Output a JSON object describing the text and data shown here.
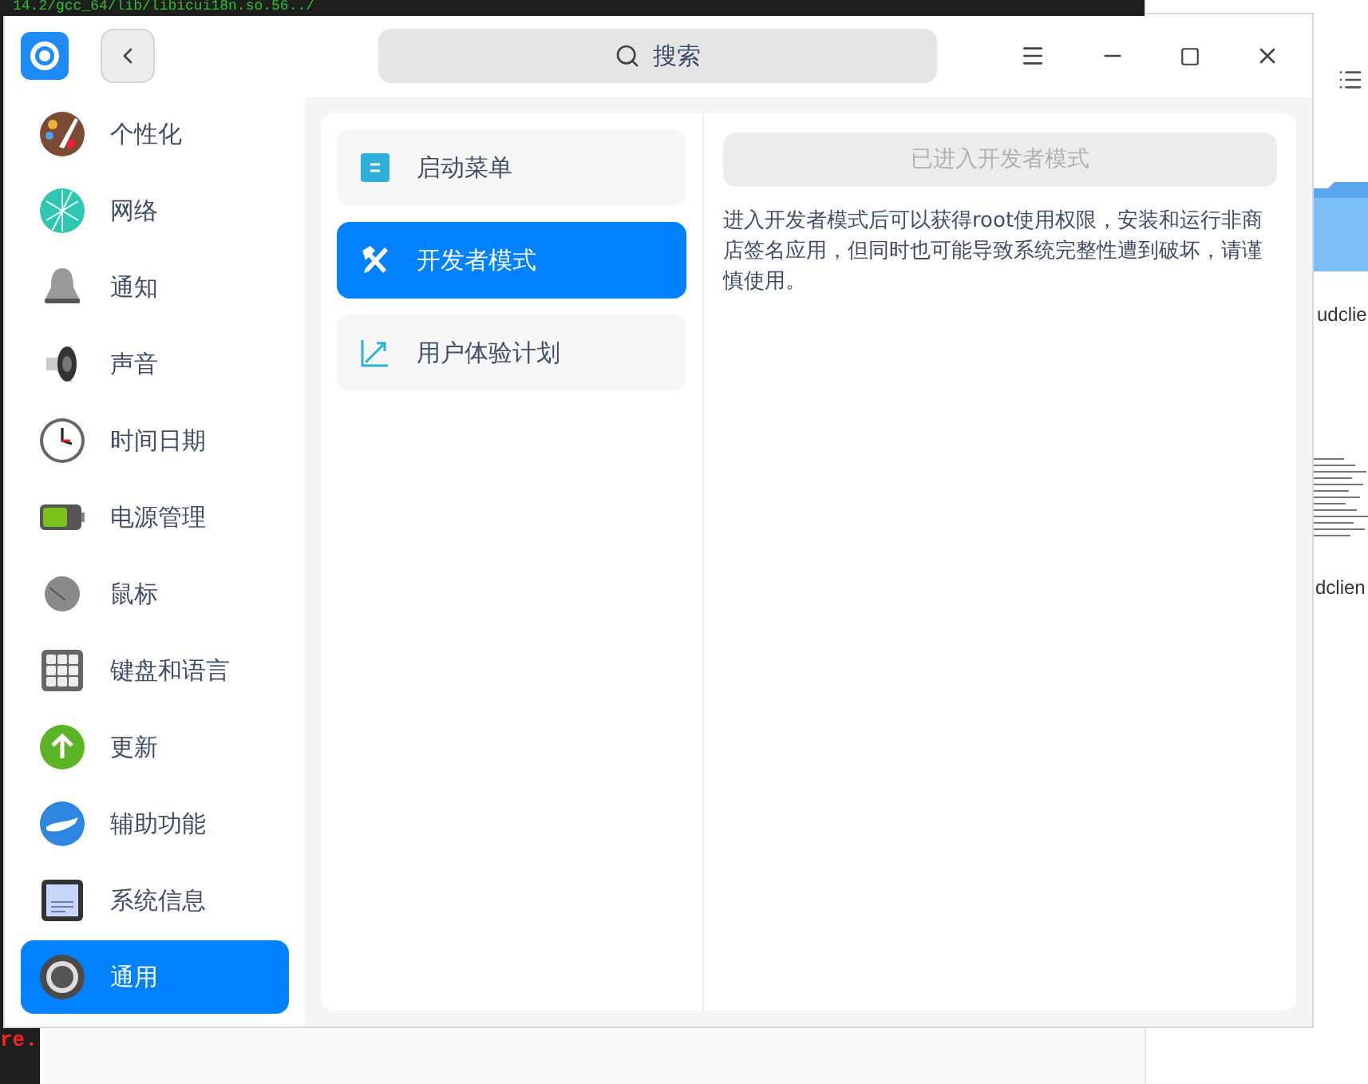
{
  "background": {
    "terminal_top_text": "14.2/gcc_64/lib/libicui18n.so.56../",
    "terminal_bottom_text": "re.",
    "file_labels": [
      "udclie",
      "dclien"
    ]
  },
  "window": {
    "search": {
      "placeholder": "搜索"
    }
  },
  "sidebar": {
    "items": [
      {
        "label": "个性化",
        "selected": false
      },
      {
        "label": "网络",
        "selected": false
      },
      {
        "label": "通知",
        "selected": false
      },
      {
        "label": "声音",
        "selected": false
      },
      {
        "label": "时间日期",
        "selected": false
      },
      {
        "label": "电源管理",
        "selected": false
      },
      {
        "label": "鼠标",
        "selected": false
      },
      {
        "label": "键盘和语言",
        "selected": false
      },
      {
        "label": "更新",
        "selected": false
      },
      {
        "label": "辅助功能",
        "selected": false
      },
      {
        "label": "系统信息",
        "selected": false
      },
      {
        "label": "通用",
        "selected": true
      }
    ]
  },
  "sub_menu": {
    "items": [
      {
        "label": "启动菜单",
        "selected": false
      },
      {
        "label": "开发者模式",
        "selected": true
      },
      {
        "label": "用户体验计划",
        "selected": false
      }
    ]
  },
  "developer_mode": {
    "button": {
      "label": "已进入开发者模式",
      "disabled": true
    },
    "description": "进入开发者模式后可以获得root使用权限，安装和运行非商店签名应用，但同时也可能导致系统完整性遭到破坏，请谨慎使用。"
  }
}
